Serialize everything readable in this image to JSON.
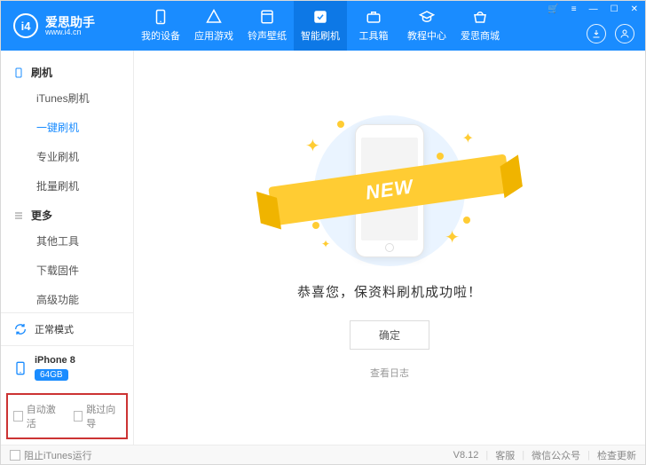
{
  "logo": {
    "badge": "i4",
    "title": "爱思助手",
    "sub": "www.i4.cn"
  },
  "nav": {
    "items": [
      {
        "label": "我的设备"
      },
      {
        "label": "应用游戏"
      },
      {
        "label": "铃声壁纸"
      },
      {
        "label": "智能刷机",
        "active": true
      },
      {
        "label": "工具箱"
      },
      {
        "label": "教程中心"
      },
      {
        "label": "爱思商城"
      }
    ]
  },
  "sidebar": {
    "group1": {
      "title": "刷机"
    },
    "items1": [
      {
        "label": "iTunes刷机"
      },
      {
        "label": "一键刷机",
        "active": true
      },
      {
        "label": "专业刷机"
      },
      {
        "label": "批量刷机"
      }
    ],
    "group2": {
      "title": "更多"
    },
    "items2": [
      {
        "label": "其他工具"
      },
      {
        "label": "下载固件"
      },
      {
        "label": "高级功能"
      }
    ],
    "mode": "正常模式",
    "device": {
      "name": "iPhone 8",
      "storage": "64GB"
    },
    "options": {
      "auto_activate": "自动激活",
      "skip_guide": "跳过向导"
    }
  },
  "main": {
    "ribbon": "NEW",
    "message": "恭喜您，保资料刷机成功啦！",
    "ok": "确定",
    "log": "查看日志"
  },
  "status": {
    "block_itunes": "阻止iTunes运行",
    "version": "V8.12",
    "links": [
      "客服",
      "微信公众号",
      "检查更新"
    ]
  }
}
